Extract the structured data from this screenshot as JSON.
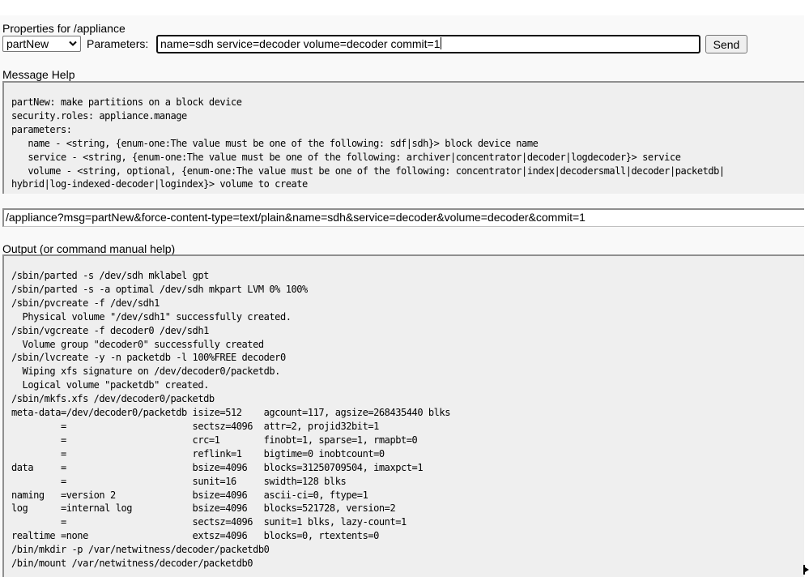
{
  "header": {
    "title": "Properties for /appliance"
  },
  "form": {
    "message_select": {
      "selected": "partNew"
    },
    "parameters_label": "Parameters:",
    "parameters_value": "name=sdh service=decoder volume=decoder commit=1",
    "send_label": "Send"
  },
  "help": {
    "title": "Message Help",
    "lines": [
      "partNew: make partitions on a block device",
      "security.roles: appliance.manage",
      "parameters:",
      "   name - <string, {enum-one:The value must be one of the following: sdf|sdh}> block device name",
      "   service - <string, {enum-one:The value must be one of the following: archiver|concentrator|decoder|logdecoder}> service",
      "   volume - <string, optional, {enum-one:The value must be one of the following: concentrator|index|decodersmall|decoder|packetdb|",
      "hybrid|log-indexed-decoder|logindex}> volume to create"
    ]
  },
  "request_url": "/appliance?msg=partNew&force-content-type=text/plain&name=sdh&service=decoder&volume=decoder&commit=1",
  "output": {
    "title": "Output (or command manual help)",
    "lines": [
      "/sbin/parted -s /dev/sdh mklabel gpt",
      "/sbin/parted -s -a optimal /dev/sdh mkpart LVM 0% 100%",
      "/sbin/pvcreate -f /dev/sdh1",
      "  Physical volume \"/dev/sdh1\" successfully created.",
      "/sbin/vgcreate -f decoder0 /dev/sdh1",
      "  Volume group \"decoder0\" successfully created",
      "/sbin/lvcreate -y -n packetdb -l 100%FREE decoder0",
      "  Wiping xfs signature on /dev/decoder0/packetdb.",
      "  Logical volume \"packetdb\" created.",
      "/sbin/mkfs.xfs /dev/decoder0/packetdb",
      "meta-data=/dev/decoder0/packetdb isize=512    agcount=117, agsize=268435440 blks",
      "         =                       sectsz=4096  attr=2, projid32bit=1",
      "         =                       crc=1        finobt=1, sparse=1, rmapbt=0",
      "         =                       reflink=1    bigtime=0 inobtcount=0",
      "data     =                       bsize=4096   blocks=31250709504, imaxpct=1",
      "         =                       sunit=16     swidth=128 blks",
      "naming   =version 2              bsize=4096   ascii-ci=0, ftype=1",
      "log      =internal log           bsize=4096   blocks=521728, version=2",
      "         =                       sectsz=4096  sunit=1 blks, lazy-count=1",
      "realtime =none                   extsz=4096   blocks=0, rtextents=0",
      "/bin/mkdir -p /var/netwitness/decoder/packetdb0",
      "/bin/mount /var/netwitness/decoder/packetdb0"
    ]
  },
  "icons": {
    "select_arrow": "chevron-down-icon",
    "mouse_cursor": "pointer-cursor-icon"
  }
}
